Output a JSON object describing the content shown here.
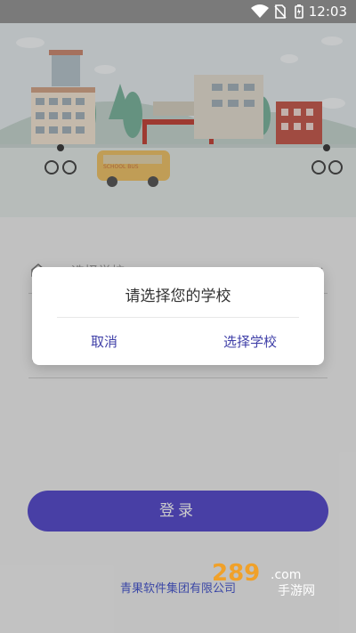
{
  "status": {
    "time": "12:03"
  },
  "form": {
    "school_placeholder": "选择学校"
  },
  "dialog": {
    "title": "请选择您的学校",
    "cancel": "取消",
    "select": "选择学校"
  },
  "login": {
    "label": "登录"
  },
  "footer": {
    "text": "青果软件集团有限公司"
  },
  "hero": {
    "bus_sign": "SCHOOL BUS"
  },
  "watermark": {
    "text": "289.com 手游网"
  },
  "colors": {
    "accent": "#5a4fcf",
    "dialog_btn": "#4040a8",
    "footer": "#4b5bd0"
  }
}
